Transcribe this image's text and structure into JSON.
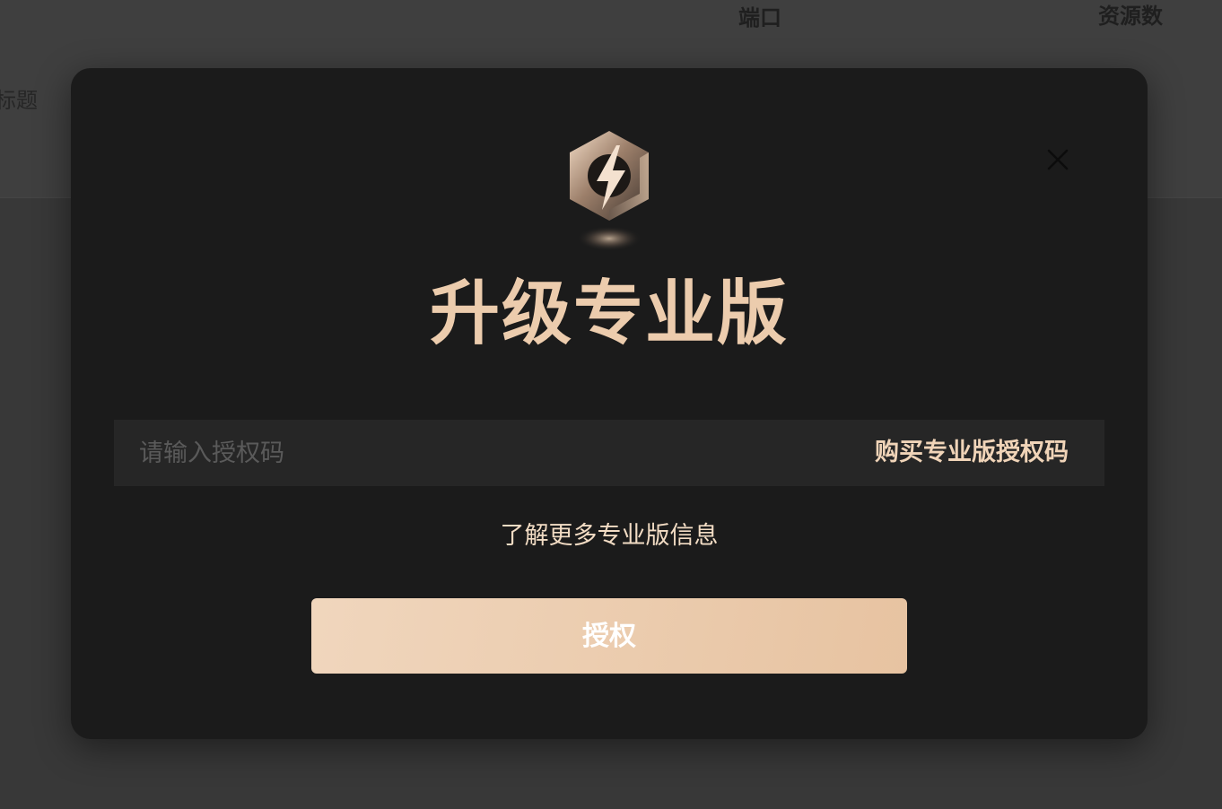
{
  "background": {
    "columns": {
      "port": "端口",
      "resources": "资源数",
      "title_partial": "标题"
    }
  },
  "modal": {
    "logo_icon": "lightning-hexagon-icon",
    "close_icon": "close-icon",
    "heading": "升级专业版",
    "license_input": {
      "value": "",
      "placeholder": "请输入授权码"
    },
    "buy_link": "购买专业版授权码",
    "learn_more_link": "了解更多专业版信息",
    "authorize_button": "授权"
  },
  "colors": {
    "modal_bg": "#1b1b1b",
    "gold_text": "#ecccad",
    "button_gradient_start": "#f0d6bd",
    "button_gradient_end": "#e7c3a1",
    "input_bg": "#262626",
    "backdrop": "#383838"
  }
}
